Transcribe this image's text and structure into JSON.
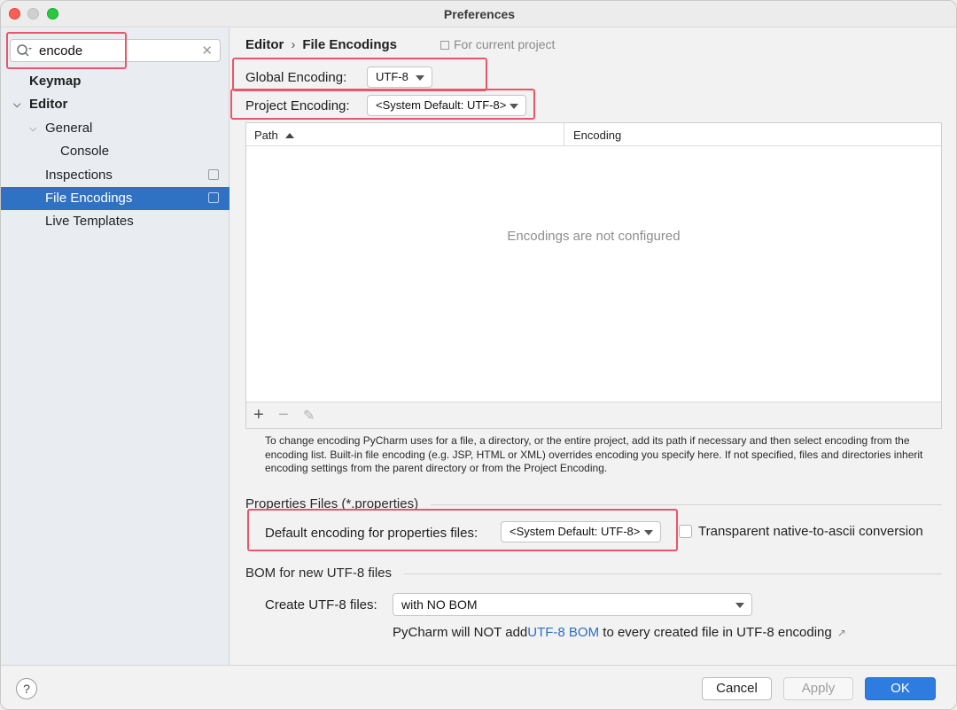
{
  "window": {
    "title": "Preferences"
  },
  "sidebar": {
    "search": {
      "value": "encode"
    },
    "items": [
      {
        "label": "Keymap"
      },
      {
        "label": "Editor"
      },
      {
        "label": "General"
      },
      {
        "label": "Console"
      },
      {
        "label": "Inspections"
      },
      {
        "label": "File Encodings"
      },
      {
        "label": "Live Templates"
      }
    ],
    "selected": "File Encodings"
  },
  "main": {
    "breadcrumb": {
      "parent": "Editor",
      "separator": "›",
      "current": "File Encodings"
    },
    "scope_note": "For current project",
    "global_encoding": {
      "label": "Global Encoding:",
      "value": "UTF-8"
    },
    "project_encoding": {
      "label": "Project Encoding:",
      "value": "<System Default: UTF-8>"
    },
    "table": {
      "columns": [
        "Path",
        "Encoding"
      ],
      "sort_column": "Path",
      "empty_text": "Encodings are not configured",
      "toolbar": {
        "add": "+",
        "remove": "−",
        "edit": "✎"
      }
    },
    "help_text": "To change encoding PyCharm uses for a file, a directory, or the entire project, add its path if necessary and then select encoding from the encoding list. Built-in file encoding (e.g. JSP, HTML or XML) overrides encoding you specify here. If not specified, files and directories inherit encoding settings from the parent directory or from the Project Encoding.",
    "properties_section": {
      "title": "Properties Files (*.properties)",
      "default_label": "Default encoding for properties files:",
      "default_value": "<System Default: UTF-8>",
      "transparent_label": "Transparent native-to-ascii conversion",
      "transparent_checked": false
    },
    "bom_section": {
      "title": "BOM for new UTF-8 files",
      "create_label": "Create UTF-8 files:",
      "create_value": "with NO BOM",
      "info_prefix": "PyCharm will NOT add",
      "info_link": "UTF-8 BOM",
      "info_suffix": " to every created file in UTF-8 encoding",
      "info_icon": "↗"
    }
  },
  "footer": {
    "help": "?",
    "cancel": "Cancel",
    "apply": "Apply",
    "ok": "OK"
  },
  "colors": {
    "accent": "#2f7ce0",
    "selection": "#2f72c4",
    "annotation_highlight": "#e8566b",
    "link": "#2c6fc2"
  }
}
